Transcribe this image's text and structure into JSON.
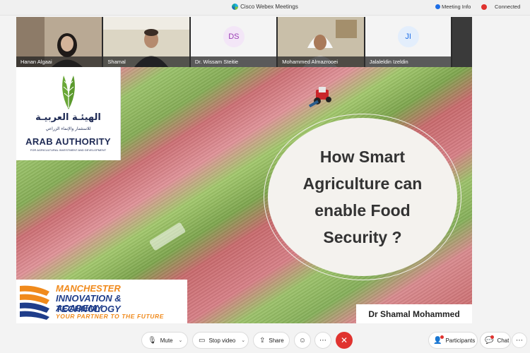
{
  "window": {
    "title": "Cisco Webex Meetings",
    "meeting_info": "Meeting Info",
    "status": "Connected"
  },
  "participants": [
    {
      "name": "Hanan Algaai",
      "type": "video"
    },
    {
      "name": "Shamal",
      "type": "video"
    },
    {
      "name": "Dr. Wissam Steitie",
      "type": "avatar",
      "initials": "DS",
      "color": "#9b3fb5"
    },
    {
      "name": "Mohammed Almazrooei",
      "type": "video"
    },
    {
      "name": "Jalaleldin Izeldin",
      "type": "avatar",
      "initials": "JI",
      "color": "#1e6ee6"
    }
  ],
  "slide": {
    "arab_authority": {
      "arabic_title": "الهيئـة العربيـة",
      "arabic_subtitle": "للاستثمار والإنماء الزراعي",
      "english_title": "ARAB AUTHORITY",
      "english_subtitle": "FOR AGRICULTURAL INVESTMENT AND DEVELOPMENT"
    },
    "title_lines": [
      "How Smart",
      "Agriculture can",
      "enable Food",
      "Security ?"
    ],
    "academy": {
      "line1": "MANCHESTER",
      "line2": "INNOVATION & TECHNOLOGY",
      "line3": "ACADEMY",
      "tagline": "YOUR PARTNER TO THE FUTURE"
    },
    "presenter": "Dr Shamal Mohammed"
  },
  "controls": {
    "mute": "Mute",
    "stop_video": "Stop video",
    "share": "Share",
    "participants": "Participants",
    "chat": "Chat"
  },
  "colors": {
    "end_call": "#e0332f",
    "academy_orange": "#f08a1c",
    "academy_blue": "#1f3d8a",
    "arab_authority_navy": "#1f2b55"
  }
}
